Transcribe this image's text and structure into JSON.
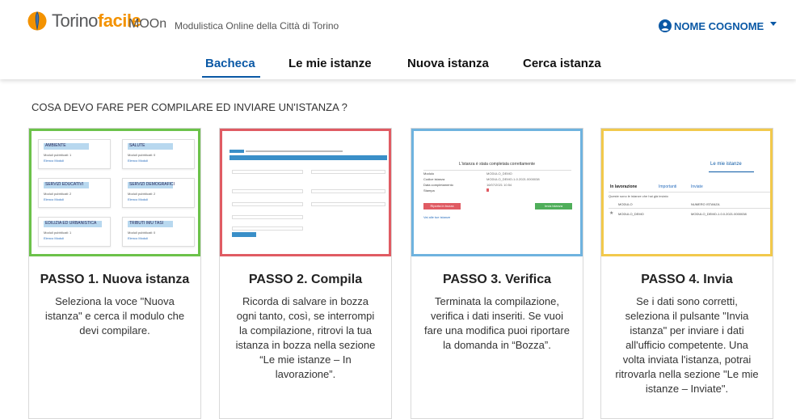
{
  "header": {
    "brand_prefix": "Torino",
    "brand_accent": "facile",
    "app_name": "MOOn",
    "app_subtitle": "Modulistica Online della Città di Torino",
    "user_name": "NOME COGNOME"
  },
  "nav": [
    {
      "label": "Bacheca",
      "active": true
    },
    {
      "label": "Le mie istanze",
      "active": false
    },
    {
      "label": "Nuova istanza",
      "active": false
    },
    {
      "label": "Cerca istanza",
      "active": false
    }
  ],
  "question": "COSA DEVO FARE PER COMPILARE ED INVIARE UN'ISTANZA ?",
  "steps": [
    {
      "title": "PASSO 1. Nuova istanza",
      "text": "Seleziona la voce \"Nuova istanza\" e cerca il modulo che devi compilare.",
      "preview": {
        "boxes": [
          {
            "head": "AMBIENTE",
            "line": "Moduli pubblicati: 1",
            "link": "Elenco Moduli"
          },
          {
            "head": "SALUTE",
            "line": "Moduli pubblicati: 0",
            "link": "Elenco Moduli"
          },
          {
            "head": "SERVIZI EDUCATIVI",
            "line": "Moduli pubblicati: 2",
            "link": "Elenco Moduli"
          },
          {
            "head": "SERVIZI DEMOGRAFICI",
            "line": "Moduli pubblicati: 2",
            "link": "Elenco Moduli"
          },
          {
            "head": "EDILIZIA ED URBANISTICA",
            "line": "Moduli pubblicati: 1",
            "link": "Elenco Moduli"
          },
          {
            "head": "TRIBUTI IMU TASI",
            "line": "Moduli pubblicati: 0",
            "link": "Elenco Moduli"
          }
        ]
      }
    },
    {
      "title": "PASSO 2. Compila",
      "text": "Ricorda di salvare in bozza ogni tanto, così, se interrompi la compilazione, ritrovi la tua istanza in bozza nella sezione “Le mie istanze – In lavorazione”."
    },
    {
      "title": "PASSO 3. Verifica",
      "text": "Terminata la compilazione, verifica i dati inseriti. Se vuoi fare una modifica puoi riportare la domanda in “Bozza”.",
      "preview": {
        "banner": "L'istanza è stata completata correttamente",
        "rows": [
          {
            "label": "Modulo",
            "value": "MODULO_DEMO"
          },
          {
            "label": "Codice istanza",
            "value": "MODULO_DEMO-1-0.2021.0000038"
          },
          {
            "label": "Data completamento",
            "value": "16/07/2021 10:54"
          },
          {
            "label": "Stampa",
            "value": ""
          }
        ],
        "left_button": "Riporta in bozza",
        "right_button": "Invia istanza",
        "footer_link": "Vai alle tue istanze"
      }
    },
    {
      "title": "PASSO 4. Invia",
      "text": "Se i dati sono corretti, seleziona il pulsante \"Invia istanza\" per inviare i dati all'ufficio competente. Una volta inviata l'istanza, potrai ritrovarla nella sezione \"Le mie istanze – Inviate\".",
      "preview": {
        "title": "Le mie istanze",
        "tabs": [
          "In lavorazione",
          "Importanti",
          "Inviate"
        ],
        "note": "Queste sono le istanze che hai già inviato",
        "col1": "MODULO",
        "col2": "NUMERO ISTANZA",
        "row_module": "MODULO_DEMO",
        "row_number": "MODULO_DEMO-1.0.0.2021.0000038"
      }
    }
  ],
  "colors": {
    "primary": "#0a58a5",
    "brand_orange": "#f39200",
    "step1_border": "#6cc24a",
    "step2_border": "#e05b63",
    "step3_border": "#6fb3df",
    "step4_border": "#f2c94c"
  }
}
